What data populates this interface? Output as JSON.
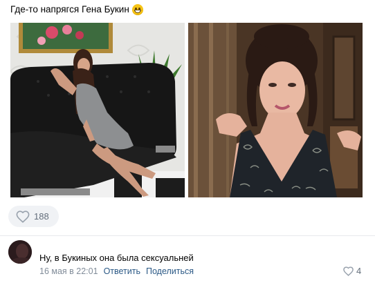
{
  "post": {
    "text": "Где-то напрягся Гена Букин",
    "emoji_icon": "grinning-face-emoji",
    "photos": [
      {
        "name": "photo-woman-on-black-sofa"
      },
      {
        "name": "photo-woman-in-dark-dress"
      }
    ],
    "likes": {
      "icon": "heart-icon",
      "count": "188"
    }
  },
  "comment": {
    "text": "Ну, в Букиных она была сексуальней",
    "date": "16 мая в 22:01",
    "reply_label": "Ответить",
    "share_label": "Поделиться",
    "likes": {
      "icon": "heart-icon",
      "count": "4"
    }
  },
  "colors": {
    "link": "#2a5885",
    "meta": "#818c99",
    "like_bg": "#f0f2f5",
    "divider": "#e7e8ec"
  }
}
